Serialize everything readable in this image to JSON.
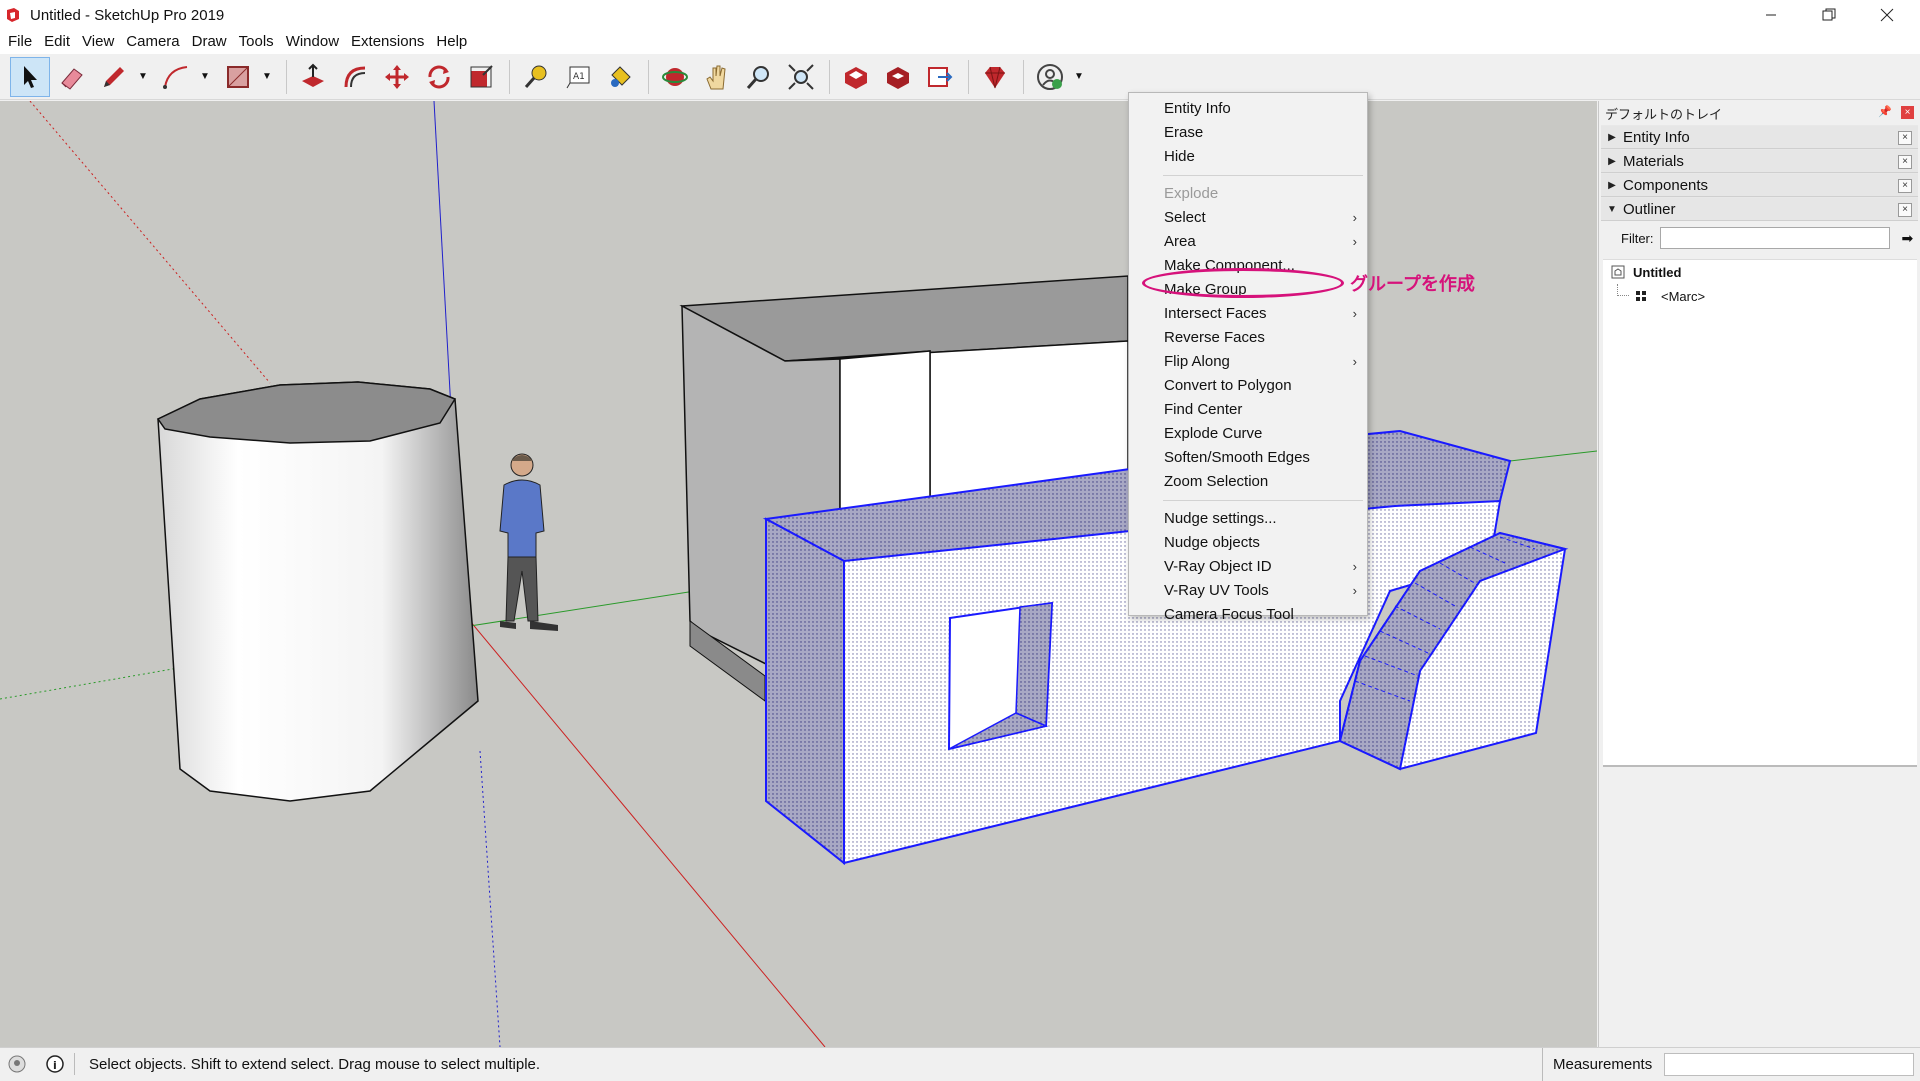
{
  "window": {
    "title": "Untitled - SketchUp Pro 2019",
    "controls": [
      "minimize",
      "maximize",
      "close"
    ]
  },
  "menubar": [
    "File",
    "Edit",
    "View",
    "Camera",
    "Draw",
    "Tools",
    "Window",
    "Extensions",
    "Help"
  ],
  "toolbar": {
    "tools": [
      {
        "name": "select-tool",
        "icon": "arrow-cursor-icon",
        "active": true
      },
      {
        "name": "eraser-tool",
        "icon": "eraser-icon"
      },
      {
        "name": "pencil-tool",
        "icon": "pencil-icon"
      },
      {
        "name": "arc-tool",
        "icon": "arc-icon"
      },
      {
        "name": "rectangle-tool",
        "icon": "rectangle-icon"
      },
      {
        "name": "push-pull-tool",
        "icon": "push-pull-icon"
      },
      {
        "name": "offset-tool",
        "icon": "offset-icon"
      },
      {
        "name": "move-tool",
        "icon": "move-icon"
      },
      {
        "name": "rotate-tool",
        "icon": "rotate-icon"
      },
      {
        "name": "scale-tool",
        "icon": "scale-icon"
      },
      {
        "name": "tape-measure-tool",
        "icon": "tape-measure-icon"
      },
      {
        "name": "text-tool",
        "icon": "text-icon"
      },
      {
        "name": "paint-bucket-tool",
        "icon": "paint-bucket-icon"
      },
      {
        "name": "orbit-tool",
        "icon": "orbit-icon"
      },
      {
        "name": "pan-tool",
        "icon": "hand-icon"
      },
      {
        "name": "zoom-tool",
        "icon": "magnifier-icon"
      },
      {
        "name": "zoom-extents-tool",
        "icon": "zoom-extents-icon"
      },
      {
        "name": "3d-warehouse-tool",
        "icon": "warehouse-icon"
      },
      {
        "name": "extension-warehouse-tool",
        "icon": "extension-warehouse-icon"
      },
      {
        "name": "send-to-layout-tool",
        "icon": "layout-icon"
      },
      {
        "name": "extension-manager-tool",
        "icon": "ruby-gem-icon"
      },
      {
        "name": "account-tool",
        "icon": "user-account-icon"
      }
    ]
  },
  "context_menu": {
    "items": [
      {
        "label": "Entity Info"
      },
      {
        "label": "Erase"
      },
      {
        "label": "Hide"
      },
      {
        "separator": true
      },
      {
        "label": "Explode",
        "disabled": true
      },
      {
        "label": "Select",
        "submenu": true
      },
      {
        "label": "Area",
        "submenu": true
      },
      {
        "label": "Make Component..."
      },
      {
        "label": "Make Group"
      },
      {
        "label": "Intersect Faces",
        "submenu": true
      },
      {
        "label": "Reverse Faces"
      },
      {
        "label": "Flip Along",
        "submenu": true
      },
      {
        "label": "Convert to Polygon"
      },
      {
        "label": "Find Center"
      },
      {
        "label": "Explode Curve"
      },
      {
        "label": "Soften/Smooth Edges"
      },
      {
        "label": "Zoom Selection"
      },
      {
        "separator": true
      },
      {
        "label": "Nudge settings..."
      },
      {
        "label": "Nudge objects"
      },
      {
        "label": "V-Ray Object ID",
        "submenu": true
      },
      {
        "label": "V-Ray UV Tools",
        "submenu": true
      },
      {
        "label": "Camera Focus Tool"
      }
    ],
    "submenu_arrow": "›"
  },
  "annotation": {
    "text": "グループを作成",
    "color": "#d6127b"
  },
  "tray": {
    "title": "デフォルトのトレイ",
    "panels": [
      {
        "label": "Entity Info",
        "expanded": false
      },
      {
        "label": "Materials",
        "expanded": false
      },
      {
        "label": "Components",
        "expanded": false
      },
      {
        "label": "Outliner",
        "expanded": true
      }
    ],
    "filter_label": "Filter:",
    "filter_value": "",
    "outliner": {
      "root": "Untitled",
      "children": [
        "<Marc>"
      ]
    }
  },
  "statusbar": {
    "text": "Select objects. Shift to extend select. Drag mouse to select multiple.",
    "measurements_label": "Measurements",
    "measurements_value": ""
  },
  "colors": {
    "selection": "#1a1aff",
    "highlight": "#d6127b",
    "axis_red": "#cc2020",
    "axis_green": "#2a9a2a",
    "axis_blue": "#2020cc"
  }
}
